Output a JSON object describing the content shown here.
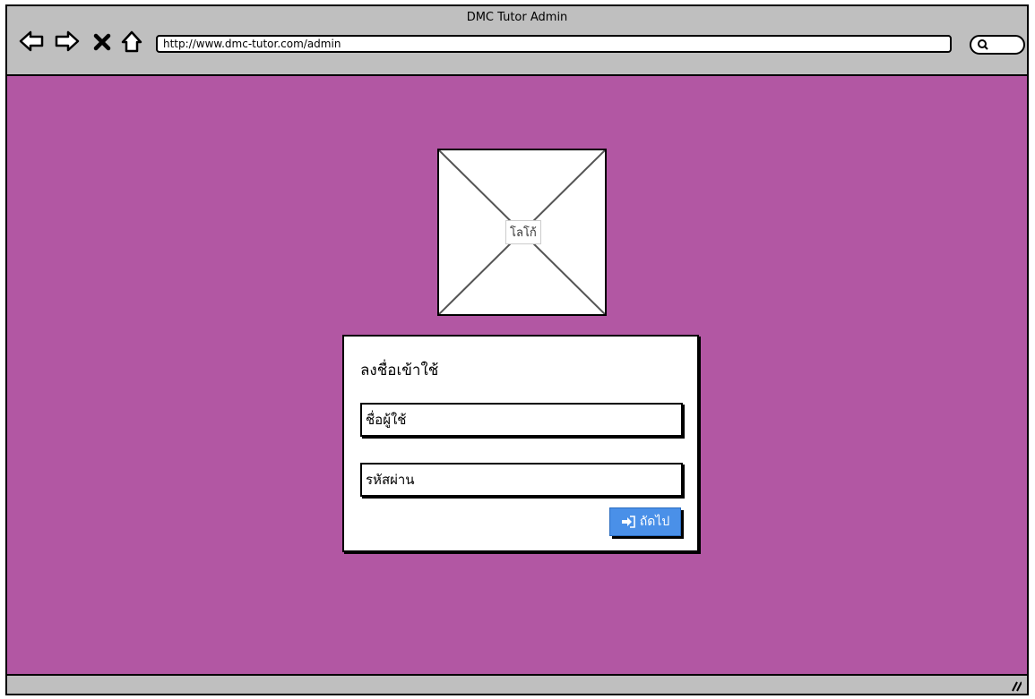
{
  "window": {
    "title": "DMC Tutor Admin"
  },
  "toolbar": {
    "url": "http://www.dmc-tutor.com/admin",
    "icons": [
      "back-icon",
      "forward-icon",
      "close-icon",
      "home-icon",
      "search-icon"
    ]
  },
  "logo": {
    "label": "โลโก้"
  },
  "login": {
    "title": "ลงชื่อเข้าใช้",
    "username_placeholder": "ชื่อผู้ใช้",
    "password_placeholder": "รหัสผ่าน",
    "next_label": "ถัดไป"
  },
  "colors": {
    "background": "#b257a3",
    "button": "#4a90e8",
    "chrome": "#bfbfbf"
  }
}
